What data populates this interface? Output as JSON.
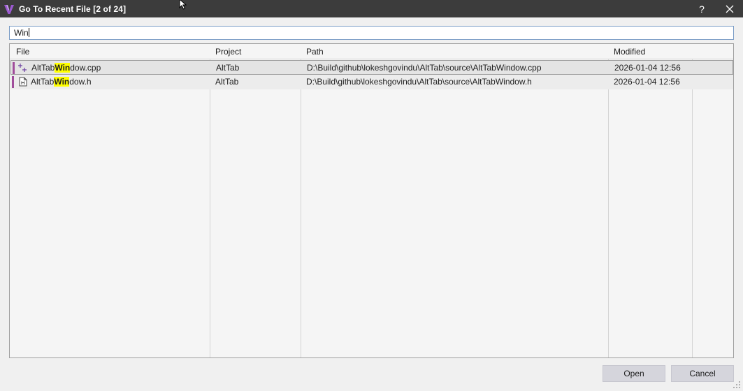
{
  "window": {
    "title": "Go To Recent File [2 of 24]",
    "help_label": "?",
    "close_label": "✕"
  },
  "search": {
    "value": "Win"
  },
  "table": {
    "columns": [
      "File",
      "Project",
      "Path",
      "Modified"
    ],
    "rows": [
      {
        "file_prefix": "AltTab",
        "file_match": "Win",
        "file_suffix": "dow.cpp",
        "file_icon": "cpp-file-icon",
        "project": "AltTab",
        "path": "D:\\Build\\github\\lokeshgovindu\\AltTab\\source\\AltTabWindow.cpp",
        "modified": "2026-01-04 12:56",
        "selected": true
      },
      {
        "file_prefix": "AltTab",
        "file_match": "Win",
        "file_suffix": "dow.h",
        "file_icon": "header-file-icon",
        "project": "AltTab",
        "path": "D:\\Build\\github\\lokeshgovindu\\AltTab\\source\\AltTabWindow.h",
        "modified": "2026-01-04 12:56",
        "selected": false
      }
    ]
  },
  "buttons": {
    "open": "Open",
    "cancel": "Cancel"
  },
  "colors": {
    "titlebar": "#3c3c3c",
    "highlight": "#ffff00",
    "row_marker": "#a04d9b",
    "logo": "#9b59d0"
  }
}
